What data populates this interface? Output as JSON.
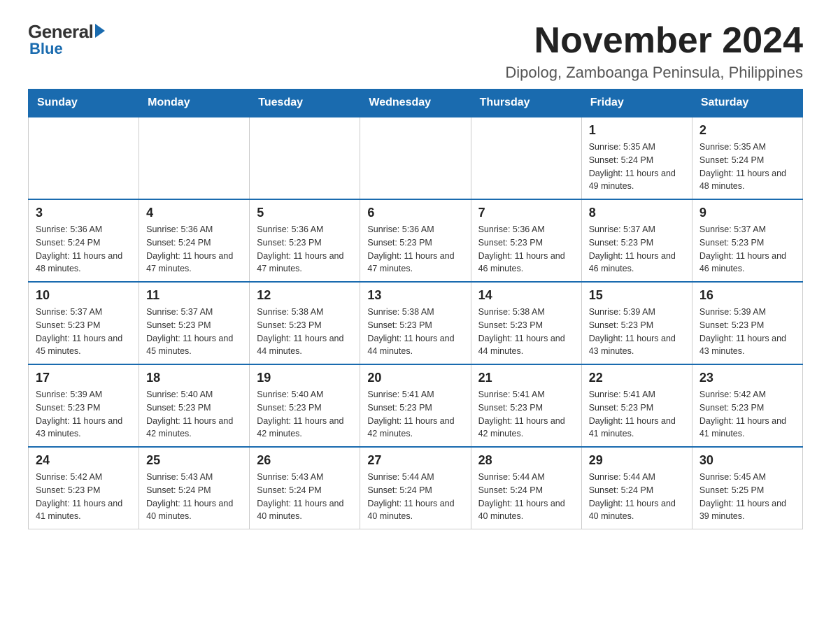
{
  "logo": {
    "general": "General",
    "blue": "Blue"
  },
  "title": "November 2024",
  "subtitle": "Dipolog, Zamboanga Peninsula, Philippines",
  "days_of_week": [
    "Sunday",
    "Monday",
    "Tuesday",
    "Wednesday",
    "Thursday",
    "Friday",
    "Saturday"
  ],
  "weeks": [
    [
      {
        "day": "",
        "info": ""
      },
      {
        "day": "",
        "info": ""
      },
      {
        "day": "",
        "info": ""
      },
      {
        "day": "",
        "info": ""
      },
      {
        "day": "",
        "info": ""
      },
      {
        "day": "1",
        "info": "Sunrise: 5:35 AM\nSunset: 5:24 PM\nDaylight: 11 hours and 49 minutes."
      },
      {
        "day": "2",
        "info": "Sunrise: 5:35 AM\nSunset: 5:24 PM\nDaylight: 11 hours and 48 minutes."
      }
    ],
    [
      {
        "day": "3",
        "info": "Sunrise: 5:36 AM\nSunset: 5:24 PM\nDaylight: 11 hours and 48 minutes."
      },
      {
        "day": "4",
        "info": "Sunrise: 5:36 AM\nSunset: 5:24 PM\nDaylight: 11 hours and 47 minutes."
      },
      {
        "day": "5",
        "info": "Sunrise: 5:36 AM\nSunset: 5:23 PM\nDaylight: 11 hours and 47 minutes."
      },
      {
        "day": "6",
        "info": "Sunrise: 5:36 AM\nSunset: 5:23 PM\nDaylight: 11 hours and 47 minutes."
      },
      {
        "day": "7",
        "info": "Sunrise: 5:36 AM\nSunset: 5:23 PM\nDaylight: 11 hours and 46 minutes."
      },
      {
        "day": "8",
        "info": "Sunrise: 5:37 AM\nSunset: 5:23 PM\nDaylight: 11 hours and 46 minutes."
      },
      {
        "day": "9",
        "info": "Sunrise: 5:37 AM\nSunset: 5:23 PM\nDaylight: 11 hours and 46 minutes."
      }
    ],
    [
      {
        "day": "10",
        "info": "Sunrise: 5:37 AM\nSunset: 5:23 PM\nDaylight: 11 hours and 45 minutes."
      },
      {
        "day": "11",
        "info": "Sunrise: 5:37 AM\nSunset: 5:23 PM\nDaylight: 11 hours and 45 minutes."
      },
      {
        "day": "12",
        "info": "Sunrise: 5:38 AM\nSunset: 5:23 PM\nDaylight: 11 hours and 44 minutes."
      },
      {
        "day": "13",
        "info": "Sunrise: 5:38 AM\nSunset: 5:23 PM\nDaylight: 11 hours and 44 minutes."
      },
      {
        "day": "14",
        "info": "Sunrise: 5:38 AM\nSunset: 5:23 PM\nDaylight: 11 hours and 44 minutes."
      },
      {
        "day": "15",
        "info": "Sunrise: 5:39 AM\nSunset: 5:23 PM\nDaylight: 11 hours and 43 minutes."
      },
      {
        "day": "16",
        "info": "Sunrise: 5:39 AM\nSunset: 5:23 PM\nDaylight: 11 hours and 43 minutes."
      }
    ],
    [
      {
        "day": "17",
        "info": "Sunrise: 5:39 AM\nSunset: 5:23 PM\nDaylight: 11 hours and 43 minutes."
      },
      {
        "day": "18",
        "info": "Sunrise: 5:40 AM\nSunset: 5:23 PM\nDaylight: 11 hours and 42 minutes."
      },
      {
        "day": "19",
        "info": "Sunrise: 5:40 AM\nSunset: 5:23 PM\nDaylight: 11 hours and 42 minutes."
      },
      {
        "day": "20",
        "info": "Sunrise: 5:41 AM\nSunset: 5:23 PM\nDaylight: 11 hours and 42 minutes."
      },
      {
        "day": "21",
        "info": "Sunrise: 5:41 AM\nSunset: 5:23 PM\nDaylight: 11 hours and 42 minutes."
      },
      {
        "day": "22",
        "info": "Sunrise: 5:41 AM\nSunset: 5:23 PM\nDaylight: 11 hours and 41 minutes."
      },
      {
        "day": "23",
        "info": "Sunrise: 5:42 AM\nSunset: 5:23 PM\nDaylight: 11 hours and 41 minutes."
      }
    ],
    [
      {
        "day": "24",
        "info": "Sunrise: 5:42 AM\nSunset: 5:23 PM\nDaylight: 11 hours and 41 minutes."
      },
      {
        "day": "25",
        "info": "Sunrise: 5:43 AM\nSunset: 5:24 PM\nDaylight: 11 hours and 40 minutes."
      },
      {
        "day": "26",
        "info": "Sunrise: 5:43 AM\nSunset: 5:24 PM\nDaylight: 11 hours and 40 minutes."
      },
      {
        "day": "27",
        "info": "Sunrise: 5:44 AM\nSunset: 5:24 PM\nDaylight: 11 hours and 40 minutes."
      },
      {
        "day": "28",
        "info": "Sunrise: 5:44 AM\nSunset: 5:24 PM\nDaylight: 11 hours and 40 minutes."
      },
      {
        "day": "29",
        "info": "Sunrise: 5:44 AM\nSunset: 5:24 PM\nDaylight: 11 hours and 40 minutes."
      },
      {
        "day": "30",
        "info": "Sunrise: 5:45 AM\nSunset: 5:25 PM\nDaylight: 11 hours and 39 minutes."
      }
    ]
  ]
}
